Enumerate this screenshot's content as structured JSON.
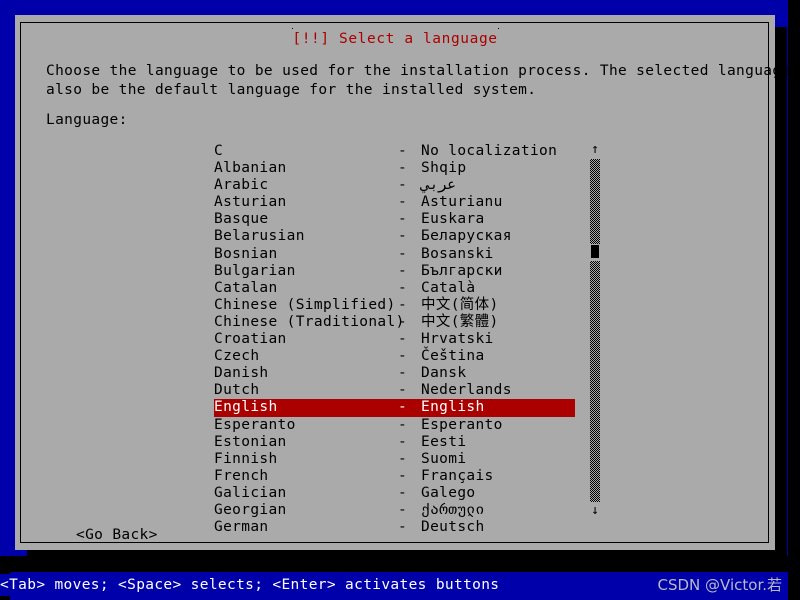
{
  "dialog": {
    "title": "[!!] Select a language",
    "intro_line1": "Choose the language to be used for the installation process. The selected language will",
    "intro_line2": "also be the default language for the installed system.",
    "language_label": "Language:",
    "go_back_label": "<Go Back>"
  },
  "list": {
    "separator": "-",
    "items": [
      {
        "name": "C",
        "native": "No localization",
        "selected": false
      },
      {
        "name": "Albanian",
        "native": "Shqip",
        "selected": false
      },
      {
        "name": "Arabic",
        "native": "عربي",
        "selected": false
      },
      {
        "name": "Asturian",
        "native": "Asturianu",
        "selected": false
      },
      {
        "name": "Basque",
        "native": "Euskara",
        "selected": false
      },
      {
        "name": "Belarusian",
        "native": "Беларуская",
        "selected": false
      },
      {
        "name": "Bosnian",
        "native": "Bosanski",
        "selected": false
      },
      {
        "name": "Bulgarian",
        "native": "Български",
        "selected": false
      },
      {
        "name": "Catalan",
        "native": "Català",
        "selected": false
      },
      {
        "name": "Chinese (Simplified)",
        "native": "中文(简体)",
        "selected": false
      },
      {
        "name": "Chinese (Traditional)",
        "native": "中文(繁體)",
        "selected": false
      },
      {
        "name": "Croatian",
        "native": "Hrvatski",
        "selected": false
      },
      {
        "name": "Czech",
        "native": "Čeština",
        "selected": false
      },
      {
        "name": "Danish",
        "native": "Dansk",
        "selected": false
      },
      {
        "name": "Dutch",
        "native": "Nederlands",
        "selected": false
      },
      {
        "name": "English",
        "native": "English",
        "selected": true
      },
      {
        "name": "Esperanto",
        "native": "Esperanto",
        "selected": false
      },
      {
        "name": "Estonian",
        "native": "Eesti",
        "selected": false
      },
      {
        "name": "Finnish",
        "native": "Suomi",
        "selected": false
      },
      {
        "name": "French",
        "native": "Français",
        "selected": false
      },
      {
        "name": "Galician",
        "native": "Galego",
        "selected": false
      },
      {
        "name": "Georgian",
        "native": "ქართული",
        "selected": false
      },
      {
        "name": "German",
        "native": "Deutsch",
        "selected": false
      }
    ]
  },
  "scrollbar": {
    "up_arrow": "↑",
    "down_arrow": "↓"
  },
  "footer": {
    "help_text": "<Tab> moves; <Space> selects; <Enter> activates buttons",
    "watermark": "CSDN @Victor.若"
  },
  "colors": {
    "background_blue": "#0000aa",
    "dialog_gray": "#aaaaaa",
    "title_red": "#aa0000",
    "highlight_red": "#aa0000",
    "highlight_text": "#ffffff",
    "text_black": "#000000",
    "footer_text": "#ffffff"
  }
}
